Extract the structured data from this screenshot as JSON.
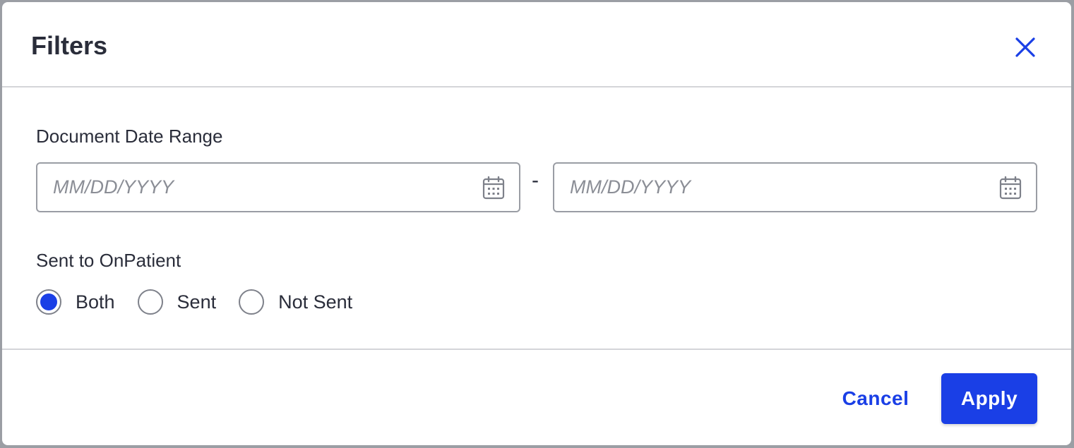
{
  "dialog": {
    "title": "Filters",
    "close_icon": "close-icon"
  },
  "date_range": {
    "label": "Document Date Range",
    "start": {
      "value": "",
      "placeholder": "MM/DD/YYYY",
      "icon": "calendar-icon"
    },
    "separator": "-",
    "end": {
      "value": "",
      "placeholder": "MM/DD/YYYY",
      "icon": "calendar-icon"
    }
  },
  "sent_filter": {
    "label": "Sent to OnPatient",
    "options": [
      {
        "label": "Both",
        "selected": true
      },
      {
        "label": "Sent",
        "selected": false
      },
      {
        "label": "Not Sent",
        "selected": false
      }
    ]
  },
  "footer": {
    "cancel_label": "Cancel",
    "apply_label": "Apply"
  },
  "colors": {
    "accent": "#1a3fe6",
    "text": "#2a2d3a",
    "placeholder": "#8b8e96",
    "border": "#9a9da4",
    "divider": "#d4d5d9"
  }
}
